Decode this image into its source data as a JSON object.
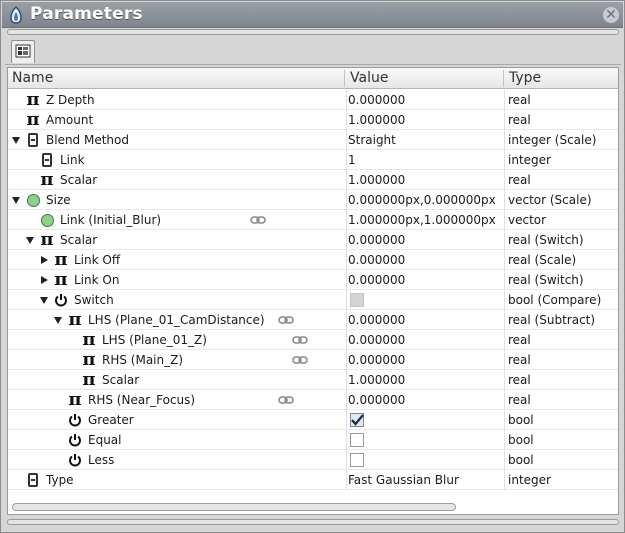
{
  "window": {
    "title": "Parameters"
  },
  "header": {
    "name": "Name",
    "value": "Value",
    "type": "Type"
  },
  "rows": [
    {
      "name": "Z Depth",
      "value": "0.000000",
      "type": "real"
    },
    {
      "name": "Amount",
      "value": "1.000000",
      "type": "real"
    },
    {
      "name": "Blend Method",
      "value": "Straight",
      "type": "integer (Scale)"
    },
    {
      "name": "Link",
      "value": "1",
      "type": "integer"
    },
    {
      "name": "Scalar",
      "value": "1.000000",
      "type": "real"
    },
    {
      "name": "Size",
      "value": "0.000000px,0.000000px",
      "type": "vector (Scale)"
    },
    {
      "name": "Link (Initial_Blur)",
      "value": "1.000000px,1.000000px",
      "type": "vector"
    },
    {
      "name": "Scalar",
      "value": "0.000000",
      "type": "real (Switch)"
    },
    {
      "name": "Link Off",
      "value": "0.000000",
      "type": "real (Scale)"
    },
    {
      "name": "Link On",
      "value": "0.000000",
      "type": "real (Switch)"
    },
    {
      "name": "Switch",
      "value": "",
      "type": "bool (Compare)"
    },
    {
      "name": "LHS (Plane_01_CamDistance)",
      "value": "0.000000",
      "type": "real (Subtract)"
    },
    {
      "name": "LHS (Plane_01_Z)",
      "value": "0.000000",
      "type": "real"
    },
    {
      "name": "RHS (Main_Z)",
      "value": "0.000000",
      "type": "real"
    },
    {
      "name": "Scalar",
      "value": "1.000000",
      "type": "real"
    },
    {
      "name": "RHS (Near_Focus)",
      "value": "0.000000",
      "type": "real"
    },
    {
      "name": "Greater",
      "value": "",
      "type": "bool"
    },
    {
      "name": "Equal",
      "value": "",
      "type": "bool"
    },
    {
      "name": "Less",
      "value": "",
      "type": "bool"
    },
    {
      "name": "Type",
      "value": "Fast Gaussian Blur",
      "type": "integer"
    }
  ],
  "checkboxes": {
    "switch": false,
    "greater": true,
    "equal": false,
    "less": false
  }
}
